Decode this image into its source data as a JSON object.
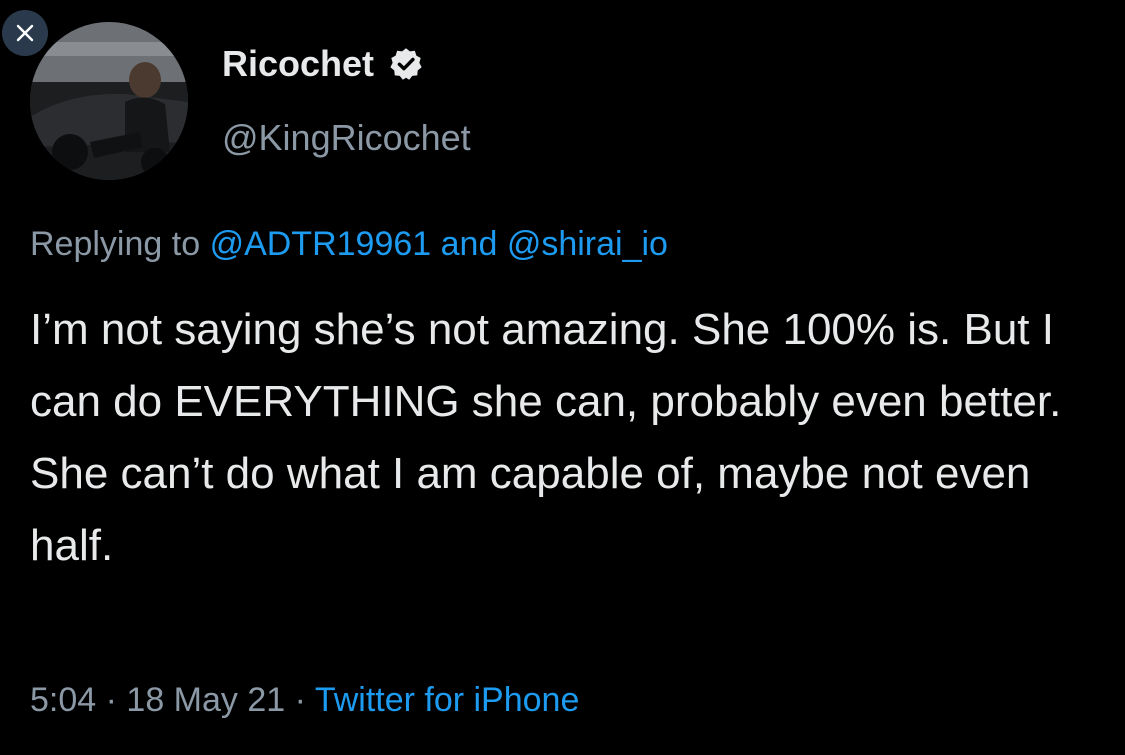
{
  "tweet": {
    "author": {
      "display_name": "Ricochet",
      "handle": "@KingRicochet",
      "verified_icon": "verified-badge-icon",
      "avatar": "profile-photo"
    },
    "reply": {
      "prefix": "Replying to",
      "mention_1": "@ADTR19961",
      "joiner": "and",
      "mention_2": "@shirai_io"
    },
    "text": "I’m not saying she’s not amazing. She 100% is. But I can do EVERYTHING she can, probably even better. She can’t do what I am capable of, maybe not even half.",
    "time": "5:04",
    "separator": "·",
    "date": "18 May 21",
    "source": "Twitter for iPhone"
  },
  "ui": {
    "close_icon": "close-icon"
  },
  "colors": {
    "background": "#000000",
    "text": "#e7e9ea",
    "secondary": "#8b98a5",
    "link": "#1d9bf0"
  }
}
